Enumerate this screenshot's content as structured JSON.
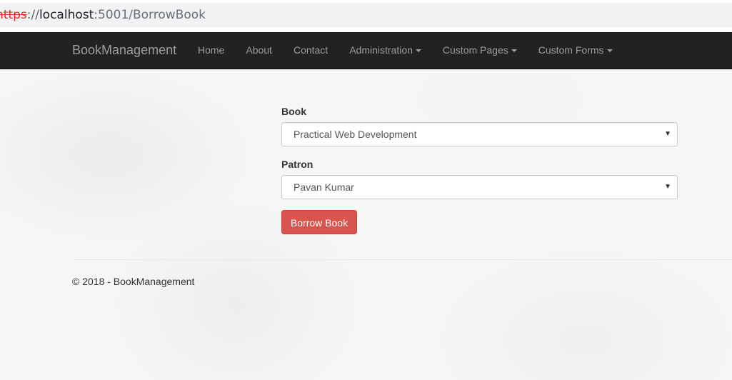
{
  "browser": {
    "url_scheme": "https",
    "url_sep": "://",
    "url_host": "localhost",
    "url_rest": ":5001/BorrowBook"
  },
  "navbar": {
    "brand": "BookManagement",
    "items": [
      {
        "label": "Home",
        "dropdown": false
      },
      {
        "label": "About",
        "dropdown": false
      },
      {
        "label": "Contact",
        "dropdown": false
      },
      {
        "label": "Administration",
        "dropdown": true
      },
      {
        "label": "Custom Pages",
        "dropdown": true
      },
      {
        "label": "Custom Forms",
        "dropdown": true
      }
    ]
  },
  "form": {
    "book_label": "Book",
    "book_value": "Practical Web Development",
    "patron_label": "Patron",
    "patron_value": "Pavan Kumar",
    "submit_label": "Borrow Book",
    "arrow_icon": "triangle-down-icon"
  },
  "footer": {
    "text": "© 2018 - BookManagement"
  },
  "colors": {
    "navbar_bg": "#222222",
    "nav_text": "#9d9d9d",
    "danger_button": "#d9534f",
    "insecure_scheme": "#d93025"
  }
}
